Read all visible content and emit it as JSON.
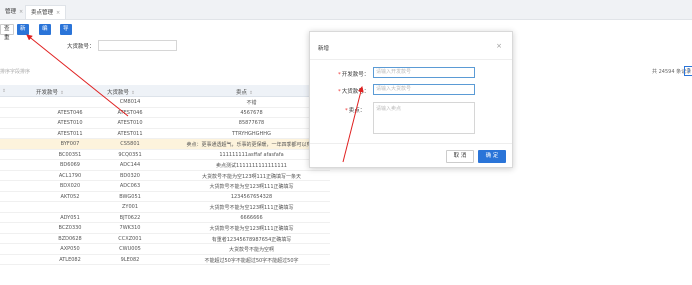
{
  "tabs": [
    {
      "label": "管理"
    },
    {
      "label": "卖点管理"
    }
  ],
  "toolbar": {
    "query_label": "查重",
    "add_label": "新增",
    "edit_label": "编辑",
    "import_label": "导入"
  },
  "search": {
    "label": "大货款号：",
    "value": ""
  },
  "placeholder_strip": "排序字段排序",
  "table": {
    "headers": [
      "",
      "开发款号",
      "大货款号",
      "卖点"
    ],
    "rows": [
      {
        "c0": "",
        "c1": "",
        "c2": "CM8014",
        "c3": "不错"
      },
      {
        "c0": "",
        "c1": "ATEST046",
        "c2": "ATEST046",
        "c3": "4567678"
      },
      {
        "c0": "",
        "c1": "ATEST010",
        "c2": "ATEST010",
        "c3": "85877678"
      },
      {
        "c0": "",
        "c1": "ATEST011",
        "c2": "ATEST011",
        "c3": "TTRYHGHGHHG"
      },
      {
        "c0": "",
        "c1": "BYF007",
        "c2": "CS5801",
        "c3": "卖点：更事通透超气，乐事的更保暖，一年四季都可以穿。"
      },
      {
        "c0": "",
        "c1": "BC00351",
        "c2": "9CQ0351",
        "c3": "111111111asffaf afasfafa"
      },
      {
        "c0": "",
        "c1": "BD6069",
        "c2": "ADC144",
        "c3": "卖点测试1111111111111111"
      },
      {
        "c0": "",
        "c1": "ACL1790",
        "c2": "BD0320",
        "c3": "大货款号不能为空123啊111正确填写一条天"
      },
      {
        "c0": "",
        "c1": "BDX020",
        "c2": "ADC063",
        "c3": "大货款号不能为空123啊111正确填写"
      },
      {
        "c0": "",
        "c1": "AKT052",
        "c2": "BWG051",
        "c3": "1234567654328"
      },
      {
        "c0": "",
        "c1": "",
        "c2": "ZY001",
        "c3": "大货款号不能为空123啊111正确填写"
      },
      {
        "c0": "",
        "c1": "ADY051",
        "c2": "BJT0622",
        "c3": "6666666"
      },
      {
        "c0": "",
        "c1": "BCZ0330",
        "c2": "7WK310",
        "c3": "大货款号不能为空123啊111正确填写"
      },
      {
        "c0": "",
        "c1": "BZD0628",
        "c2": "CCXZ001",
        "c3": "有重者12345678987654正确填写"
      },
      {
        "c0": "",
        "c1": "AXP050",
        "c2": "CWU005",
        "c3": "大货款号不能为空啊"
      },
      {
        "c0": "",
        "c1": "ATLE082",
        "c2": "9LE082",
        "c3": "不能超过50字不能超过50字不能超过50字"
      }
    ]
  },
  "pagination": {
    "total": "共 24594 条记录",
    "page": "1"
  },
  "modal": {
    "title": "新增",
    "close": "×",
    "fields": [
      {
        "label": "开发款号：",
        "placeholder": "请输入开发款号",
        "required": true
      },
      {
        "label": "大货款号：",
        "placeholder": "请输入大货款号",
        "required": true
      },
      {
        "label": "卖点：",
        "placeholder": "请输入卖点",
        "required": true
      }
    ],
    "cancel_label": "取 消",
    "ok_label": "确 定"
  },
  "colors": {
    "primary": "#2a74d8",
    "annotation_arrow": "#e02020",
    "required_mark": "#ee3333",
    "selected_row": "#fdf3dc"
  }
}
